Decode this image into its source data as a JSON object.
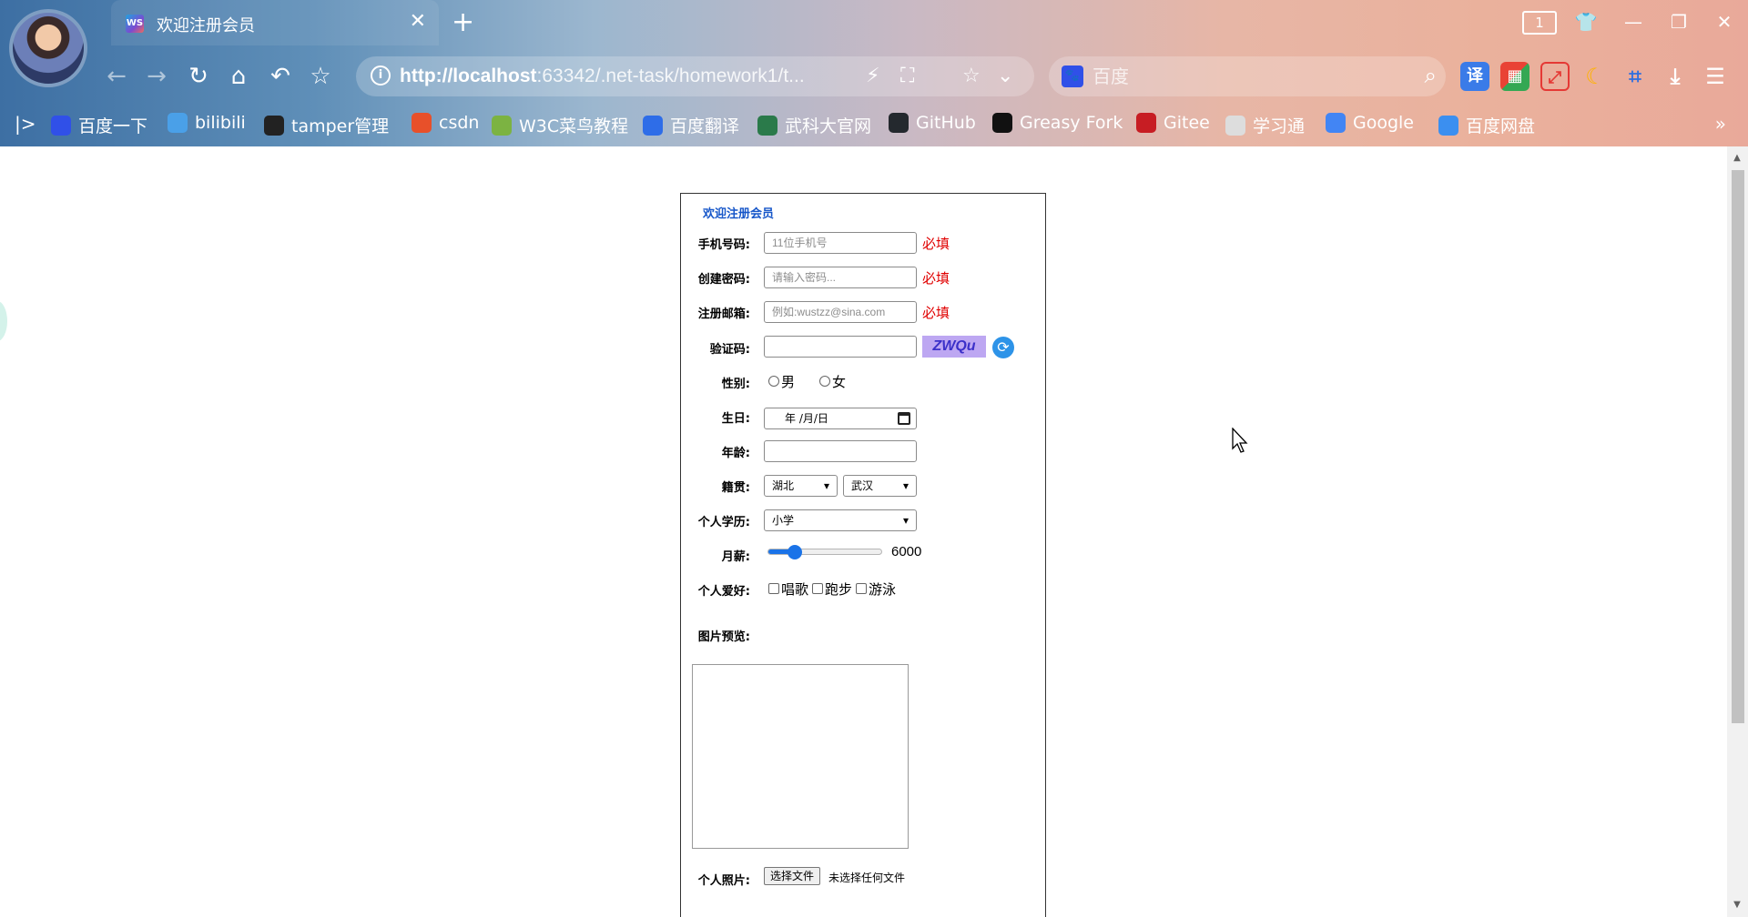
{
  "browser": {
    "tab": {
      "favicon": "WS",
      "title": "欢迎注册会员"
    },
    "tab_count": "1",
    "address": {
      "host": "http://localhost",
      "rest": ":63342/.net-task/homework1/t..."
    },
    "search": {
      "engine_icon": "baidu-paw",
      "placeholder": "百度"
    },
    "toolbar_icons": [
      "translate-icon",
      "apps-icon",
      "pdf-icon",
      "night-mode-icon",
      "screenshot-icon",
      "download-icon",
      "menu-icon"
    ],
    "bookmarks": [
      {
        "label": "百度一下",
        "icon": "baidu-icon",
        "color": "#3050e8"
      },
      {
        "label": "bilibili",
        "icon": "bilibili-icon",
        "color": "#4aa0e8"
      },
      {
        "label": "tamper管理",
        "icon": "tampermonkey-icon",
        "color": "#222222"
      },
      {
        "label": "csdn",
        "icon": "csdn-icon",
        "color": "#e8502a"
      },
      {
        "label": "W3C菜鸟教程",
        "icon": "runoob-icon",
        "color": "#7cb342"
      },
      {
        "label": "百度翻译",
        "icon": "baidu-translate-icon",
        "color": "#2e6de8"
      },
      {
        "label": "武科大官网",
        "icon": "wust-icon",
        "color": "#2a7a4a"
      },
      {
        "label": "GitHub",
        "icon": "github-icon",
        "color": "#24292e"
      },
      {
        "label": "Greasy Fork",
        "icon": "greasyfork-icon",
        "color": "#111111"
      },
      {
        "label": "Gitee",
        "icon": "gitee-icon",
        "color": "#c71d23"
      },
      {
        "label": "学习通",
        "icon": "globe-icon",
        "color": "#dddddd"
      },
      {
        "label": "Google",
        "icon": "google-icon",
        "color": "#4285f4"
      },
      {
        "label": "百度网盘",
        "icon": "baidu-pan-icon",
        "color": "#3b8ff0"
      }
    ]
  },
  "form": {
    "title": "欢迎注册会员",
    "phone": {
      "label": "手机号码:",
      "placeholder": "11位手机号",
      "required": "必填"
    },
    "password": {
      "label": "创建密码:",
      "placeholder": "请输入密码...",
      "required": "必填"
    },
    "email": {
      "label": "注册邮箱:",
      "placeholder": "例如:wustzz@sina.com",
      "required": "必填"
    },
    "captcha": {
      "label": "验证码:",
      "value": "",
      "code": "ZWQu"
    },
    "gender": {
      "label": "性别:",
      "options": [
        "男",
        "女"
      ]
    },
    "birthday": {
      "label": "生日:",
      "value": "年 /月/日"
    },
    "age": {
      "label": "年龄:",
      "value": ""
    },
    "origin": {
      "label": "籍贯:",
      "province": "湖北",
      "city": "武汉"
    },
    "education": {
      "label": "个人学历:",
      "value": "小学"
    },
    "salary": {
      "label": "月薪:",
      "value": "6000",
      "fraction": 0.24
    },
    "hobbies": {
      "label": "个人爱好:",
      "options": [
        "唱歌",
        "跑步",
        "游泳"
      ]
    },
    "preview": {
      "label": "图片预览:"
    },
    "photo": {
      "label": "个人照片:",
      "button": "选择文件",
      "status": "未选择任何文件"
    }
  }
}
